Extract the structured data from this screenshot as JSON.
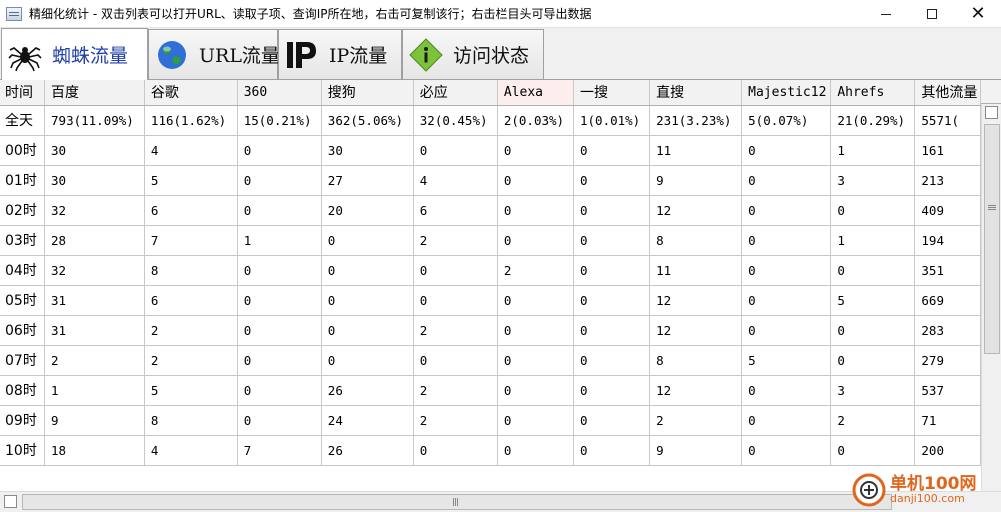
{
  "window": {
    "title": "精细化统计 - 双击列表可以打开URL、读取子项、查询IP所在地，右击可复制该行；右击栏目头可导出数据",
    "minimize": "—",
    "maximize": "☐",
    "close": "✕"
  },
  "tabs": [
    {
      "label": "蜘蛛流量",
      "icon": "spider-icon",
      "active": true
    },
    {
      "label": "URL流量",
      "icon": "globe-icon",
      "active": false
    },
    {
      "label": "IP流量",
      "icon": "ip-icon",
      "active": false
    },
    {
      "label": "访问状态",
      "icon": "info-diamond-icon",
      "active": false
    }
  ],
  "table": {
    "columns": [
      "时间",
      "百度",
      "谷歌",
      "360",
      "搜狗",
      "必应",
      "Alexa",
      "一搜",
      "直搜",
      "Majestic12",
      "Ahrefs",
      "其他流量"
    ],
    "rows": [
      [
        "全天",
        "793(11.09%)",
        "116(1.62%)",
        "15(0.21%)",
        "362(5.06%)",
        "32(0.45%)",
        "2(0.03%)",
        "1(0.01%)",
        "231(3.23%)",
        "5(0.07%)",
        "21(0.29%)",
        "5571("
      ],
      [
        "00时",
        "30",
        "4",
        "0",
        "30",
        "0",
        "0",
        "0",
        "11",
        "0",
        "1",
        "161"
      ],
      [
        "01时",
        "30",
        "5",
        "0",
        "27",
        "4",
        "0",
        "0",
        "9",
        "0",
        "3",
        "213"
      ],
      [
        "02时",
        "32",
        "6",
        "0",
        "20",
        "6",
        "0",
        "0",
        "12",
        "0",
        "0",
        "409"
      ],
      [
        "03时",
        "28",
        "7",
        "1",
        "0",
        "2",
        "0",
        "0",
        "8",
        "0",
        "1",
        "194"
      ],
      [
        "04时",
        "32",
        "8",
        "0",
        "0",
        "0",
        "2",
        "0",
        "11",
        "0",
        "0",
        "351"
      ],
      [
        "05时",
        "31",
        "6",
        "0",
        "0",
        "0",
        "0",
        "0",
        "12",
        "0",
        "5",
        "669"
      ],
      [
        "06时",
        "31",
        "2",
        "0",
        "0",
        "2",
        "0",
        "0",
        "12",
        "0",
        "0",
        "283"
      ],
      [
        "07时",
        "2",
        "2",
        "0",
        "0",
        "0",
        "0",
        "0",
        "8",
        "5",
        "0",
        "279"
      ],
      [
        "08时",
        "1",
        "5",
        "0",
        "26",
        "2",
        "0",
        "0",
        "12",
        "0",
        "3",
        "537"
      ],
      [
        "09时",
        "9",
        "8",
        "0",
        "24",
        "2",
        "0",
        "0",
        "2",
        "0",
        "2",
        "71"
      ],
      [
        "10时",
        "18",
        "4",
        "7",
        "26",
        "0",
        "0",
        "0",
        "9",
        "0",
        "0",
        "200"
      ]
    ]
  },
  "watermark": {
    "name": "单机100网",
    "url": "danji100.com"
  },
  "colors": {
    "active_tab_text": "#1e3fa8",
    "grid_line": "#c8c8c8",
    "header_bg": "#f2f2f2",
    "alexa_header_bg": "#fdeeee",
    "watermark": "#e0661c"
  }
}
